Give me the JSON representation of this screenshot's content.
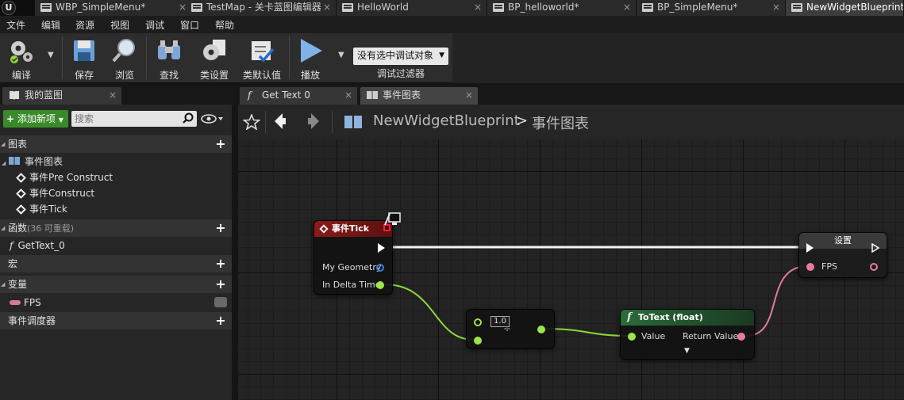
{
  "tabs": [
    {
      "label": "WBP_SimpleMenu*",
      "close": "×"
    },
    {
      "label": "TestMap - 关卡蓝图编辑器",
      "close": "×"
    },
    {
      "label": "HelloWorld",
      "close": "×"
    },
    {
      "label": "BP_helloworld*",
      "close": "×"
    },
    {
      "label": "BP_SimpleMenu*",
      "close": "×"
    },
    {
      "label": "NewWidgetBlueprint",
      "close": ""
    }
  ],
  "menu": [
    "文件",
    "编辑",
    "资源",
    "视图",
    "调试",
    "窗口",
    "帮助"
  ],
  "toolbar": {
    "compile": "编译",
    "save": "保存",
    "browse": "浏览",
    "find": "查找",
    "class_settings": "类设置",
    "class_defaults": "类默认值",
    "play": "播放",
    "debug_object": "没有选中调试对象",
    "debug_filter": "调试过滤器"
  },
  "left_panel": {
    "tab_label": "我的蓝图",
    "add_new": "添加新项",
    "search_placeholder": "搜索",
    "graphs_header": "图表",
    "event_graph": "事件图表",
    "events": [
      "事件Pre Construct",
      "事件Construct",
      "事件Tick"
    ],
    "functions_header": "函数",
    "functions_count": "(36 可重载)",
    "function_items": [
      "GetText_0"
    ],
    "macros_header": "宏",
    "variables_header": "变量",
    "variable_items": [
      "FPS"
    ],
    "dispatchers_header": "事件调度器"
  },
  "graph_tabs": [
    {
      "label": "Get Text 0",
      "close": "×"
    },
    {
      "label": "事件图表",
      "close": "×"
    }
  ],
  "breadcrumb": {
    "blueprint": "NewWidgetBlueprint",
    "separator": ">",
    "graph": "事件图表"
  },
  "nodes": {
    "tick": {
      "title": "事件Tick",
      "pin_geometry": "My Geometry",
      "pin_delta": "In Delta Time"
    },
    "divide": {
      "literal": "1.0"
    },
    "totext": {
      "title": "ToText (float)",
      "pin_value": "Value",
      "pin_return": "Return Value"
    },
    "set": {
      "title": "设置",
      "pin_fps": "FPS"
    }
  },
  "colors": {
    "accent_green": "#3a8a2a",
    "event_node_header": "#8a1a1a",
    "float_pin": "#9be44a",
    "text_pin": "#e87ba3",
    "struct_pin": "#3a7be0"
  }
}
